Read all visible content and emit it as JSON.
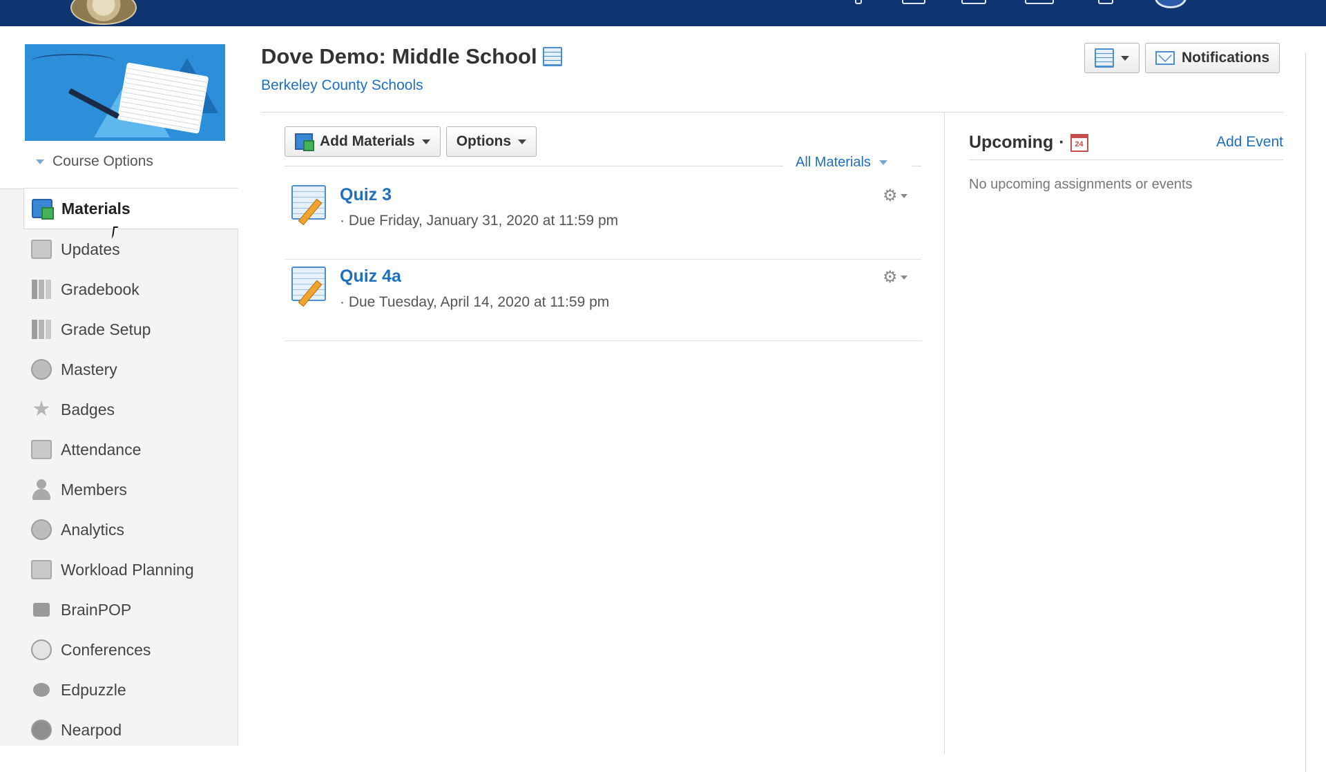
{
  "course": {
    "title": "Dove Demo: Middle School",
    "school": "Berkeley County Schools",
    "options_label": "Course Options"
  },
  "sidebar": {
    "items": [
      {
        "label": "Materials",
        "icon": "materials-icon",
        "active": true
      },
      {
        "label": "Updates",
        "icon": "updates-icon"
      },
      {
        "label": "Gradebook",
        "icon": "gradebook-icon"
      },
      {
        "label": "Grade Setup",
        "icon": "grade-setup-icon"
      },
      {
        "label": "Mastery",
        "icon": "mastery-icon"
      },
      {
        "label": "Badges",
        "icon": "star-icon"
      },
      {
        "label": "Attendance",
        "icon": "attendance-icon"
      },
      {
        "label": "Members",
        "icon": "person-icon"
      },
      {
        "label": "Analytics",
        "icon": "analytics-icon"
      },
      {
        "label": "Workload Planning",
        "icon": "workload-icon"
      },
      {
        "label": "BrainPOP",
        "icon": "brainpop-icon"
      },
      {
        "label": "Conferences",
        "icon": "conferences-icon"
      },
      {
        "label": "Edpuzzle",
        "icon": "edpuzzle-icon"
      },
      {
        "label": "Nearpod",
        "icon": "nearpod-icon"
      }
    ]
  },
  "header": {
    "notifications_label": "Notifications"
  },
  "toolbar": {
    "add_materials_label": "Add Materials",
    "options_label": "Options",
    "filter_label": "All Materials"
  },
  "materials": [
    {
      "title": "Quiz 3",
      "due": "· Due Friday, January 31, 2020 at 11:59 pm"
    },
    {
      "title": "Quiz 4a",
      "due": "· Due Tuesday, April 14, 2020 at 11:59 pm"
    }
  ],
  "upcoming": {
    "title": "Upcoming",
    "separator": "·",
    "calendar_day": "24",
    "add_event_label": "Add Event",
    "empty_message": "No upcoming assignments or events"
  },
  "colors": {
    "topbar": "#0f3470",
    "link": "#1f6fbf"
  }
}
